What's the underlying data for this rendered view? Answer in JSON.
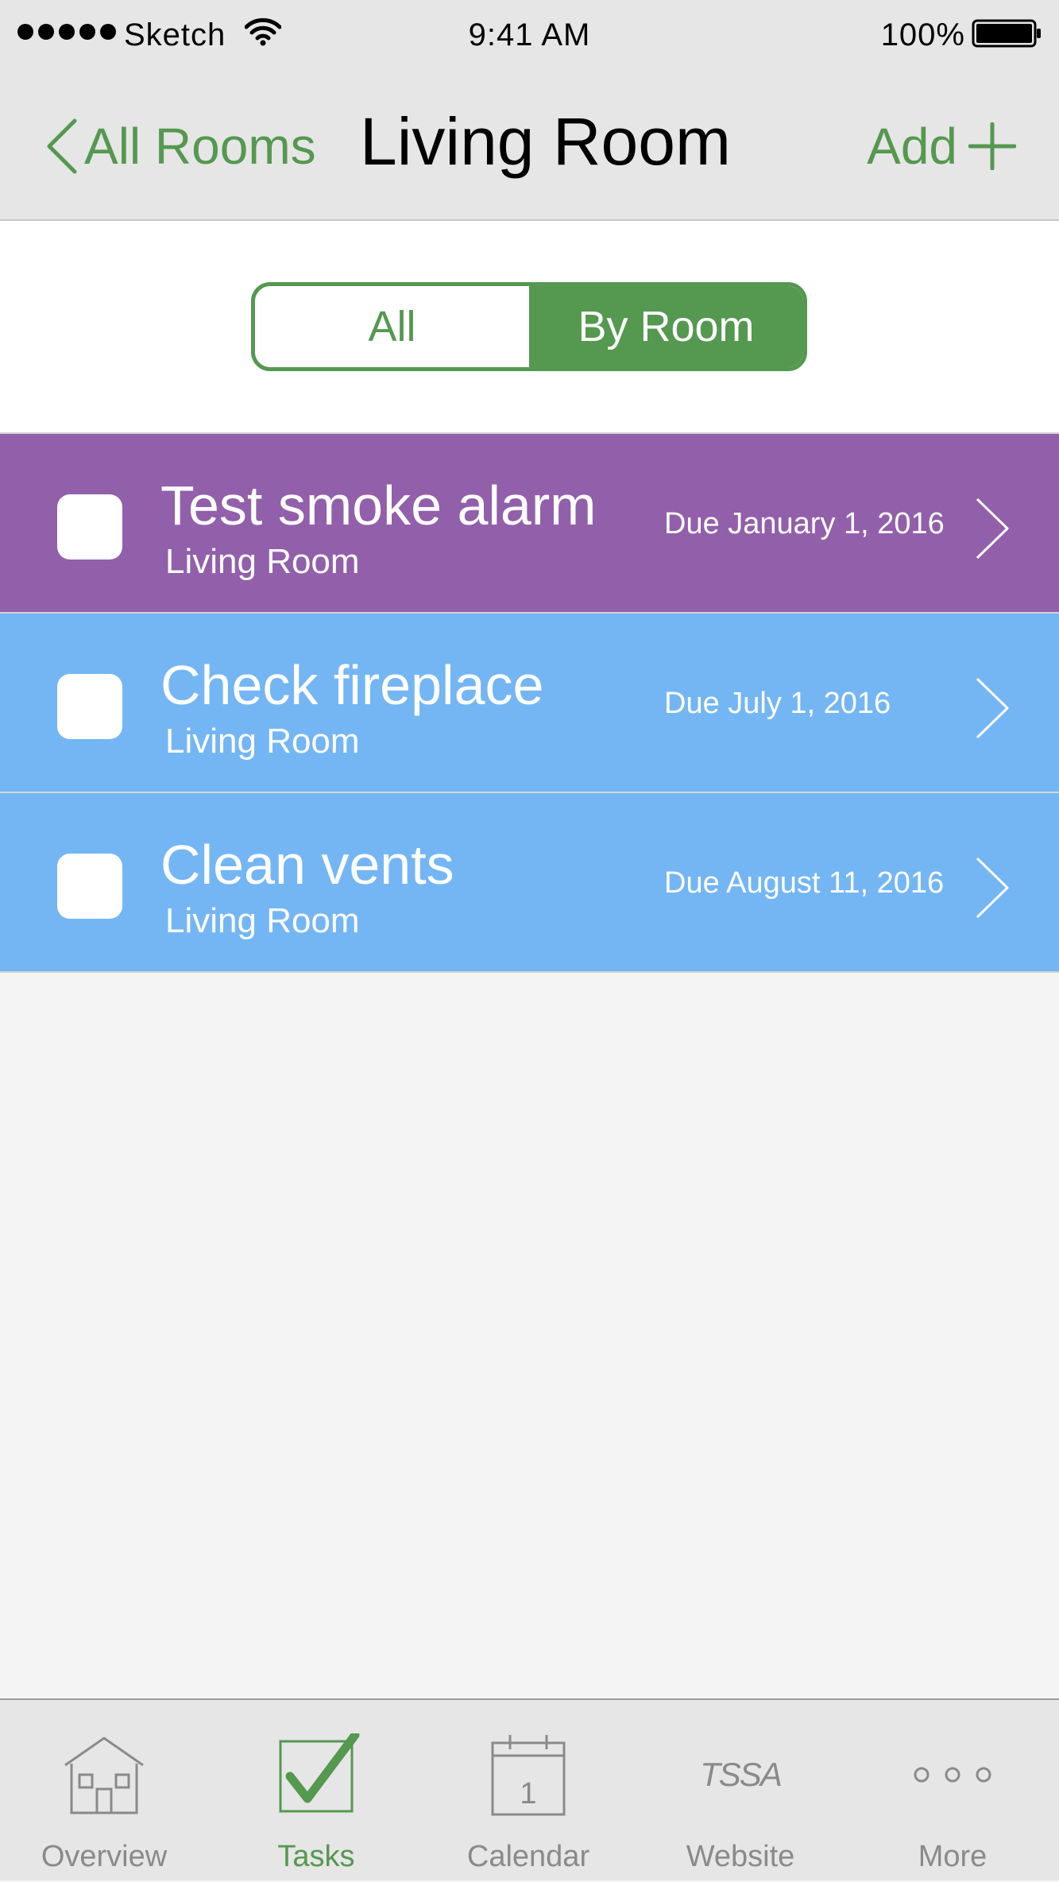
{
  "status_bar": {
    "carrier": "Sketch",
    "time": "9:41 AM",
    "battery": "100%"
  },
  "nav": {
    "back_label": "All Rooms",
    "title": "Living Room",
    "add_label": "Add"
  },
  "segmented": {
    "options": [
      "All",
      "By Room"
    ],
    "selected": "By Room"
  },
  "tasks": [
    {
      "title": "Test smoke alarm",
      "room": "Living Room",
      "due": "Due January 1, 2016",
      "color": "#925fab",
      "checked": false
    },
    {
      "title": "Check fireplace",
      "room": "Living Room",
      "due": "Due July 1, 2016",
      "color": "#74b6f4",
      "checked": false
    },
    {
      "title": "Clean vents",
      "room": "Living Room",
      "due": "Due August 11, 2016",
      "color": "#74b6f4",
      "checked": false
    }
  ],
  "tabbar": {
    "active": "Tasks",
    "tabs": [
      {
        "label": "Overview",
        "icon": "house-icon"
      },
      {
        "label": "Tasks",
        "icon": "checkbox-checked-icon"
      },
      {
        "label": "Calendar",
        "icon": "calendar-icon",
        "icon_text": "1"
      },
      {
        "label": "Website",
        "icon": "tssa-logo-icon",
        "icon_text": "TSSA"
      },
      {
        "label": "More",
        "icon": "more-icon"
      }
    ]
  },
  "colors": {
    "accent": "#559850",
    "bar_background": "#e6e6e6"
  }
}
